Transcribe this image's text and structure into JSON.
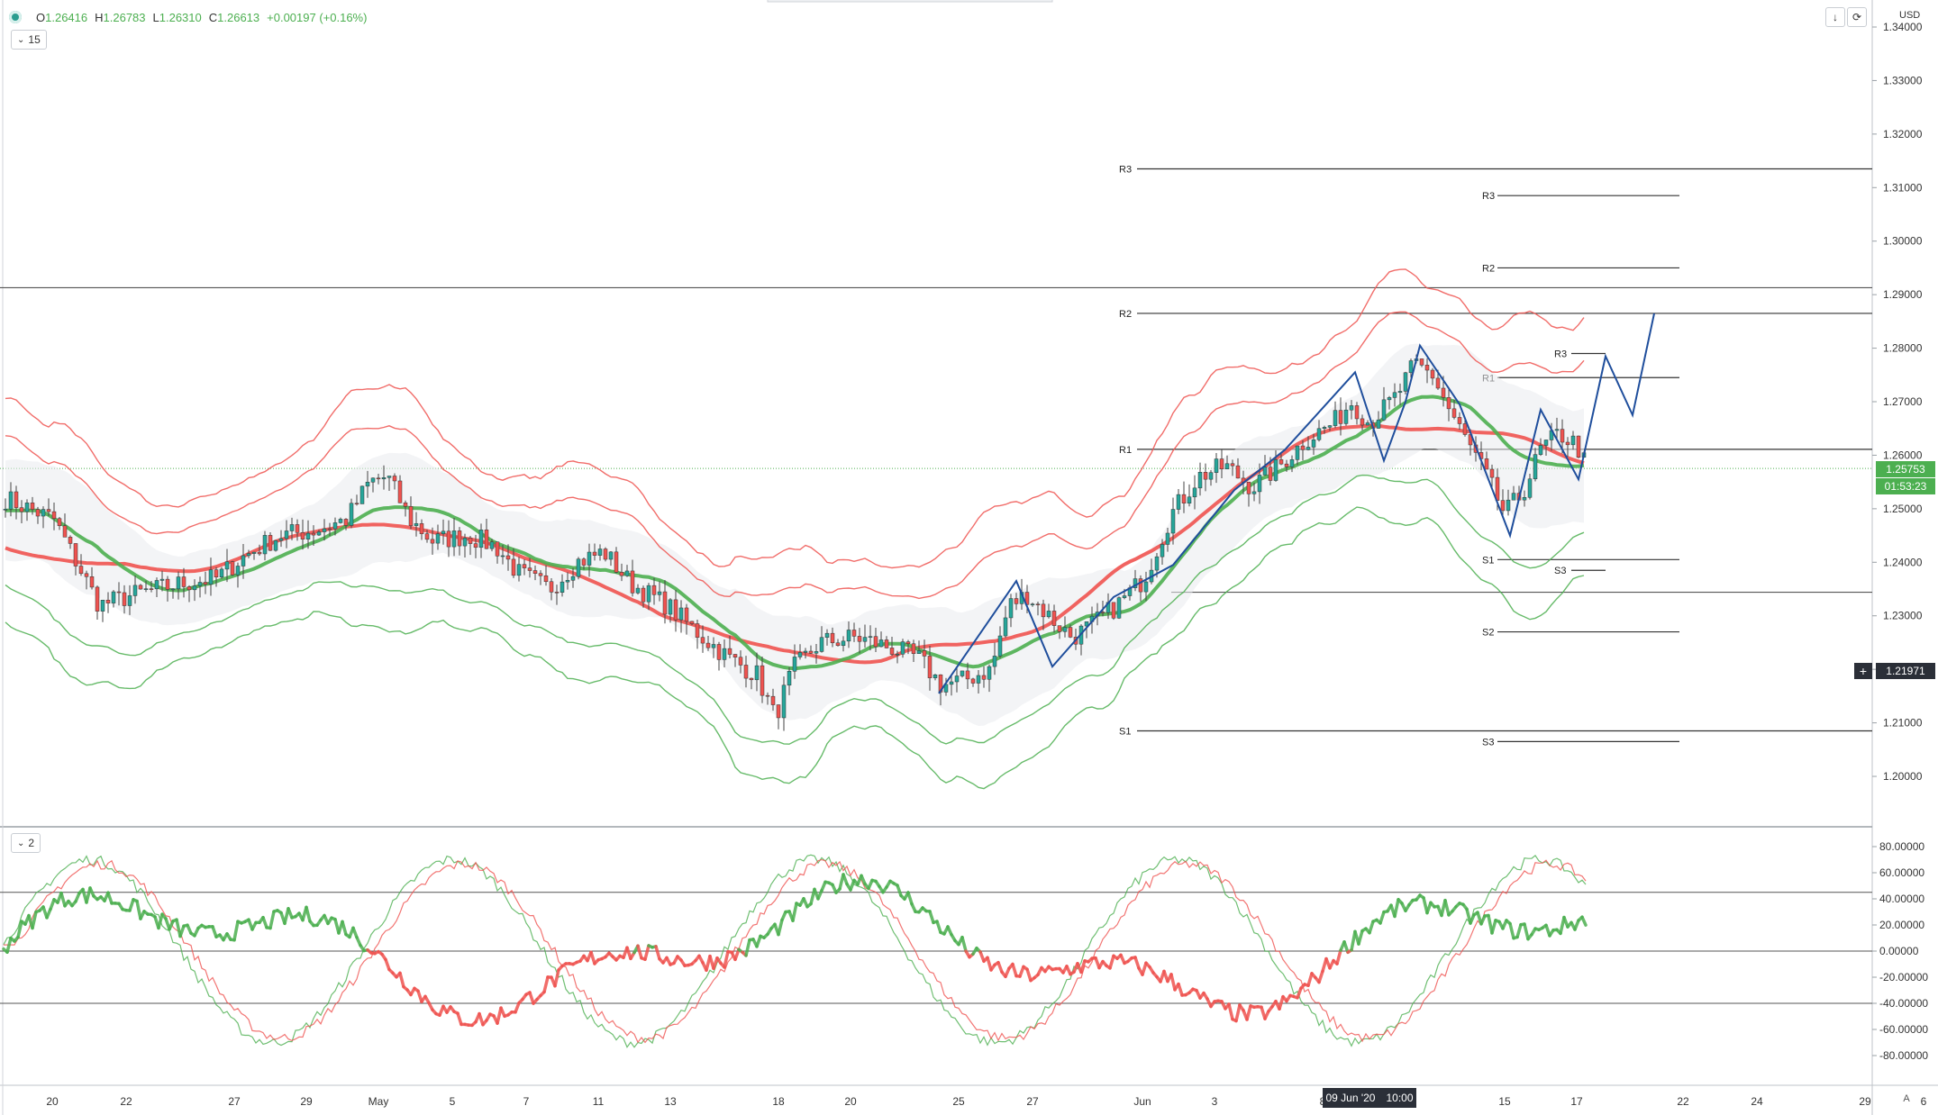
{
  "header": {
    "ohlc": {
      "o_label": "O",
      "o_value": "1.26416",
      "h_label": "H",
      "h_value": "1.26783",
      "l_label": "L",
      "l_value": "1.26310",
      "c_label": "C",
      "c_value": "1.26613",
      "change": "+0.00197 (+0.16%)"
    }
  },
  "main_indicator_label": "15",
  "osc_indicator_label": "2",
  "toolbar": {
    "download_icon": "arrow-down-icon",
    "refresh_icon": "refresh-icon"
  },
  "price_axis": {
    "currency": "USD",
    "ticks": [
      "1.34000",
      "1.33000",
      "1.32000",
      "1.31000",
      "1.30000",
      "1.29000",
      "1.28000",
      "1.27000",
      "1.26000",
      "1.25000",
      "1.24000",
      "1.23000",
      "1.22000",
      "1.21000",
      "1.20000"
    ],
    "last_price": "1.25753",
    "countdown": "01:53:23",
    "crosshair_price": "1.21971"
  },
  "osc_axis": {
    "ticks": [
      "80.00000",
      "60.00000",
      "40.00000",
      "20.00000",
      "0.00000",
      "-20.00000",
      "-40.00000",
      "-60.00000",
      "-80.00000"
    ]
  },
  "time_axis": {
    "labels": [
      "20",
      "22",
      "27",
      "29",
      "May",
      "5",
      "7",
      "11",
      "13",
      "18",
      "20",
      "25",
      "27",
      "Jun",
      "3",
      "8",
      "15",
      "17",
      "22",
      "24",
      "29",
      "6"
    ],
    "crosshair_date": "09 Jun '20",
    "crosshair_time": "10:00",
    "auto_label": "A"
  },
  "pivot_labels": {
    "a": [
      "R3",
      "R2",
      "R1",
      "S1"
    ],
    "b": [
      "R3",
      "R2",
      "R1",
      "S1",
      "S2",
      "S3"
    ],
    "c": [
      "R3",
      "S3"
    ]
  },
  "colors": {
    "up": "#26a69a",
    "down": "#ef5350",
    "band_red": "#ef5350",
    "band_green": "#4caf50",
    "pattern_blue": "#1f4e9c",
    "last_price_bg": "#4caf50",
    "axis_text": "#333333"
  },
  "chart_data": [
    {
      "type": "candlestick",
      "title": "",
      "y_range": [
        1.19,
        1.345
      ],
      "last": 1.25753,
      "ohlc_last": {
        "open": 1.26416,
        "high": 1.26783,
        "low": 1.2631,
        "close": 1.26613
      },
      "indicators": [
        "bollinger-style envelopes",
        "moving averages (red/green)",
        "pivot levels",
        "harmonic pattern lines"
      ],
      "pivot_levels": {
        "a": {
          "R3": 1.3135,
          "R2": 1.2865,
          "R1": 1.2611,
          "S1": 1.2085
        },
        "b": {
          "R3": 1.3085,
          "R2": 1.295,
          "R1": 1.2745,
          "S1": 1.2405,
          "S2": 1.227,
          "S3": 1.2065
        },
        "c": {
          "R3": 1.279,
          "S3": 1.2385
        }
      },
      "horizontal_lines": [
        1.2913,
        1.2344
      ]
    },
    {
      "type": "line",
      "title": "",
      "y_range": [
        -85,
        85
      ],
      "levels": [
        45,
        0,
        -40
      ]
    }
  ]
}
